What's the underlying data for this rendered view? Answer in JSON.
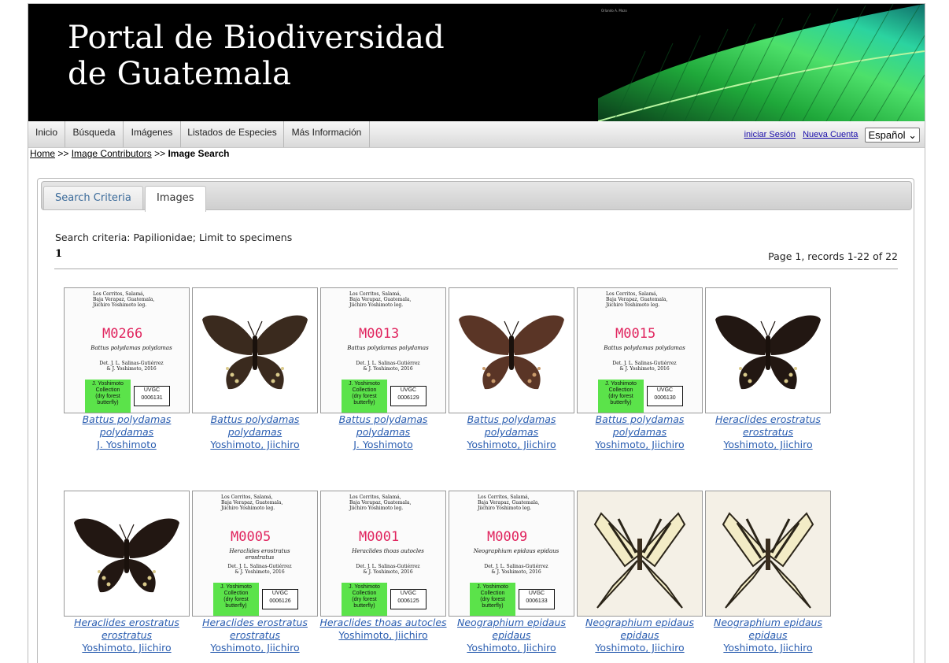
{
  "banner": {
    "title": "Portal de Biodiversidad\nde Guatemala",
    "small_text": "Orlando A. Mozo"
  },
  "nav": {
    "items": [
      "Inicio",
      "Búsqueda",
      "Imágenes",
      "Listados de Especies",
      "Más Información"
    ],
    "login": "iniciar Sesión",
    "new_account": "Nueva Cuenta",
    "language": "Español"
  },
  "breadcrumb": {
    "home": "Home",
    "sep1": ">>",
    "contributors": "Image Contributors",
    "sep2": ">>",
    "current": "Image Search"
  },
  "tabs": [
    {
      "label": "Search Criteria"
    },
    {
      "label": "Images"
    }
  ],
  "results": {
    "criteria": "Search criteria: Papilionidae; Limit to specimens",
    "page": "1",
    "records": "Page 1, records 1-22 of 22"
  },
  "images": [
    {
      "kind": "label",
      "code": "M0266",
      "species": "Battus polydamas polydamas",
      "contributor": "J. Yoshimoto",
      "catalog": "0006131"
    },
    {
      "kind": "dark",
      "species": "Battus polydamas polydamas",
      "contributor": "Yoshimoto, Jiichiro"
    },
    {
      "kind": "label",
      "code": "M0013",
      "species": "Battus polydamas polydamas",
      "contributor": "J. Yoshimoto",
      "catalog": "0006129"
    },
    {
      "kind": "brown",
      "species": "Battus polydamas polydamas",
      "contributor": "Yoshimoto, Jiichiro"
    },
    {
      "kind": "label",
      "code": "M0015",
      "species": "Battus polydamas polydamas",
      "contributor": "Yoshimoto, Jiichiro",
      "catalog": "0006130"
    },
    {
      "kind": "black",
      "species": "Heraclides erostratus erostratus",
      "contributor": "Yoshimoto, Jiichiro"
    },
    {
      "kind": "black2",
      "species": "Heraclides erostratus erostratus",
      "contributor": "Yoshimoto, Jiichiro"
    },
    {
      "kind": "label",
      "code": "M0005",
      "species": "Heraclides erostratus erostratus",
      "contributor": "Yoshimoto, Jiichiro",
      "catalog": "0006126"
    },
    {
      "kind": "label",
      "code": "M0001",
      "species": "Heraclides thoas autocles",
      "contributor": "Yoshimoto, Jiichiro",
      "catalog": "0006125"
    },
    {
      "kind": "label",
      "code": "M0009",
      "species": "Neographium epidaus epidaus",
      "contributor": "Yoshimoto, Jiichiro",
      "catalog": "0006133"
    },
    {
      "kind": "swallowtail",
      "species": "Neographium epidaus epidaus",
      "contributor": "Yoshimoto, Jiichiro"
    },
    {
      "kind": "swallowtail",
      "species": "Neographium epidaus epidaus",
      "contributor": "Yoshimoto, Jiichiro"
    }
  ],
  "label_text": {
    "locality": "Los Cerritos, Salamá,\nBaja Verapaz, Guatemala,",
    "collector": "Jiichiro Yoshimoto leg.",
    "det": "Det. J. L. Salinas-Gutiérrez\n& J. Yoshimoto, 2016",
    "collection": "J. Yoshimoto\nCollection\n(dry forest\nbutterfly)",
    "uvgc": "UVGC"
  },
  "colors": {
    "link": "#2a5db0",
    "banner_bg": "#000000",
    "label_green": "#5be34a",
    "code_red": "#e0245e"
  }
}
